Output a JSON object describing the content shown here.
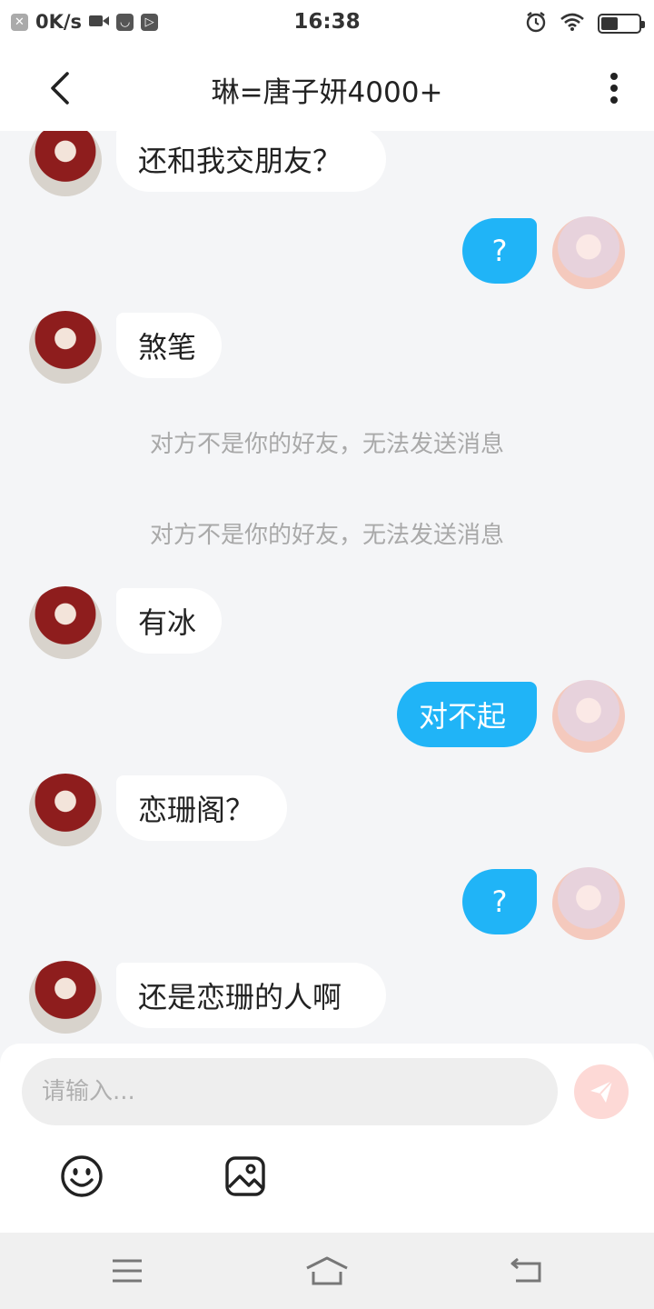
{
  "status_bar": {
    "net_speed": "0K/s",
    "time": "16:38",
    "battery_level": 0.45
  },
  "header": {
    "title": "琳=唐子妍4000+"
  },
  "messages": [
    {
      "side": "in",
      "text": "还和我交朋友？"
    },
    {
      "side": "out",
      "text": "?"
    },
    {
      "side": "in",
      "text": "煞笔"
    },
    {
      "side": "notice",
      "text": "对方不是你的好友，无法发送消息"
    },
    {
      "side": "notice",
      "text": "对方不是你的好友，无法发送消息"
    },
    {
      "side": "in",
      "text": "有冰"
    },
    {
      "side": "out",
      "text": "对不起"
    },
    {
      "side": "in",
      "text": "恋珊阁？"
    },
    {
      "side": "out",
      "text": "?"
    },
    {
      "side": "in",
      "text": "还是恋珊的人啊"
    }
  ],
  "input": {
    "placeholder": "请输入..."
  },
  "icons": {
    "back": "chevron-left-icon",
    "more": "more-vertical-icon",
    "send": "send-icon",
    "emoji": "smiley-icon",
    "image": "image-icon",
    "nav_menu": "menu-icon",
    "nav_home": "home-icon",
    "nav_back": "return-icon"
  },
  "colors": {
    "outgoing_bubble": "#20b4f7",
    "incoming_bubble": "#ffffff",
    "chat_background": "#f4f5f7",
    "notice_text": "#a9a9a9",
    "send_button": "#fdd9d6"
  }
}
